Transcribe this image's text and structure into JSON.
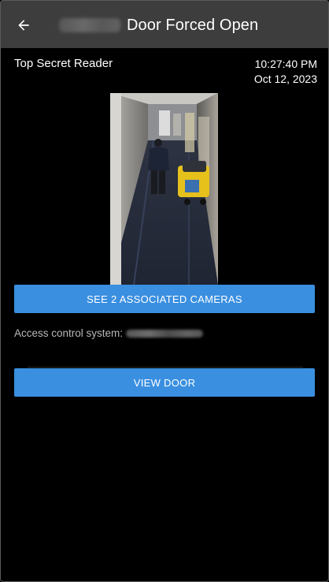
{
  "header": {
    "back_icon": "arrow-left-icon",
    "title_prefix_redacted": "OnGuard",
    "title": "Door Forced Open",
    "colors": {
      "background": "#3d3d3d",
      "text": "#ffffff"
    }
  },
  "event": {
    "reader_name": "Top Secret Reader",
    "time": "10:27:40 PM",
    "date": "Oct 12, 2023"
  },
  "buttons": {
    "cameras_label": "SEE 2 ASSOCIATED CAMERAS",
    "door_label": "VIEW DOOR",
    "color": "#3a8fe0"
  },
  "access_control": {
    "label": "Access control system:",
    "value_redacted": "Lenel - OnGuard"
  }
}
